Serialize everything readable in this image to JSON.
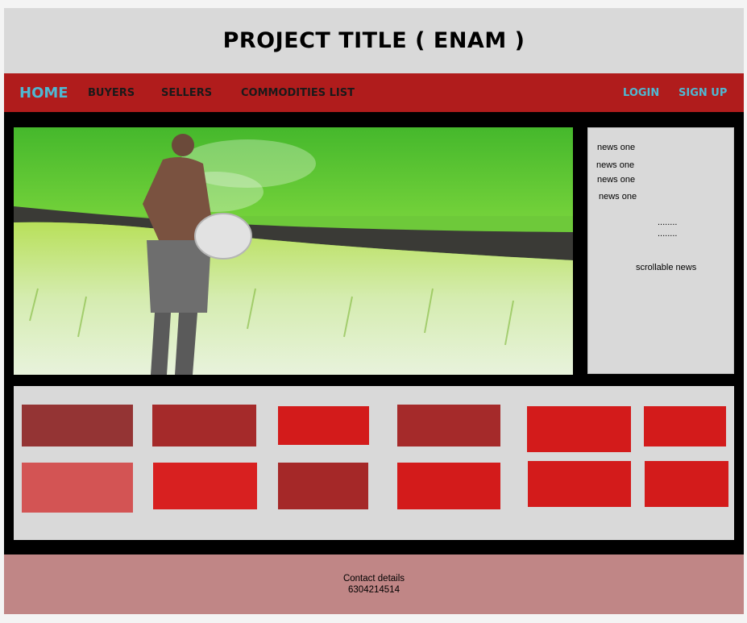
{
  "header": {
    "title": "PROJECT TITLE ( ENAM )"
  },
  "nav": {
    "home": "HOME",
    "buyers": "BUYERS",
    "sellers": "SELLERS",
    "commodities": "COMMODITIES LIST",
    "login": "LOGIN",
    "signup": "SIGN UP"
  },
  "news": {
    "items": [
      "news one",
      "news one",
      "news one",
      "news one"
    ],
    "dots": [
      "........",
      "........"
    ],
    "caption": "scrollable news"
  },
  "tiles": {
    "colors": [
      "#943434",
      "#a52a2a",
      "#d31b1b",
      "#a52a2a",
      "#d31b1b",
      "#d31b1b",
      "#d35454",
      "#d82020",
      "#a52828",
      "#d31b1b",
      "#d31b1b",
      "#d31b1b"
    ]
  },
  "footer": {
    "contact_label": "Contact details",
    "phone": "6304214514"
  }
}
